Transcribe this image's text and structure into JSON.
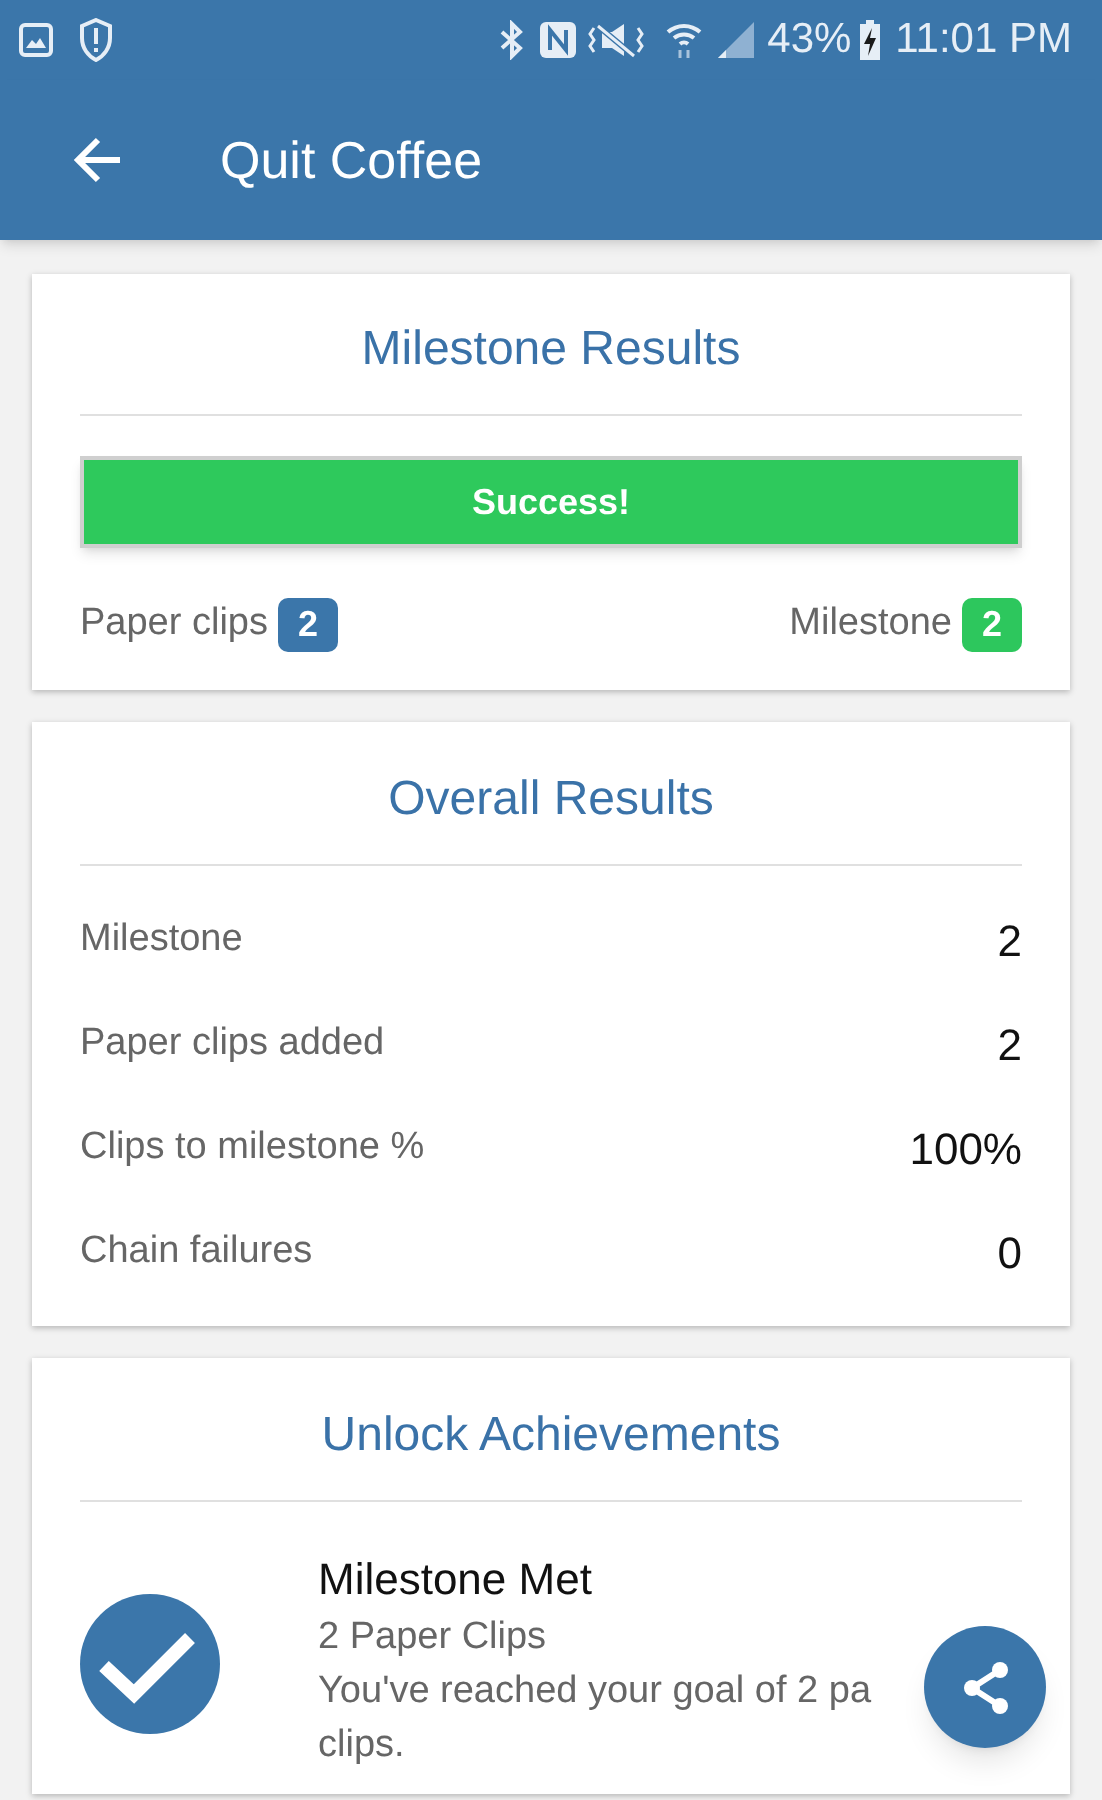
{
  "status_bar": {
    "battery": "43%",
    "time": "11:01 PM"
  },
  "app_bar": {
    "title": "Quit Coffee"
  },
  "milestone_results": {
    "title": "Milestone Results",
    "banner": "Success!",
    "badges": [
      {
        "label": "Paper clips",
        "count": "2",
        "color": "#3b76aa"
      },
      {
        "label": "Milestone",
        "count": "2",
        "color": "#2dc75d"
      }
    ]
  },
  "overall_results": {
    "title": "Overall Results",
    "rows": [
      {
        "label": "Milestone",
        "value": "2"
      },
      {
        "label": "Paper clips added",
        "value": "2"
      },
      {
        "label": "Clips to milestone %",
        "value": "100%"
      },
      {
        "label": "Chain failures",
        "value": "0"
      }
    ]
  },
  "achievements": {
    "title": "Unlock Achievements",
    "items": [
      {
        "title": "Milestone Met",
        "subtitle": "2 Paper Clips",
        "description": [
          "You've reached your goal of 2 pa",
          "clips."
        ],
        "achieved": true
      }
    ]
  }
}
